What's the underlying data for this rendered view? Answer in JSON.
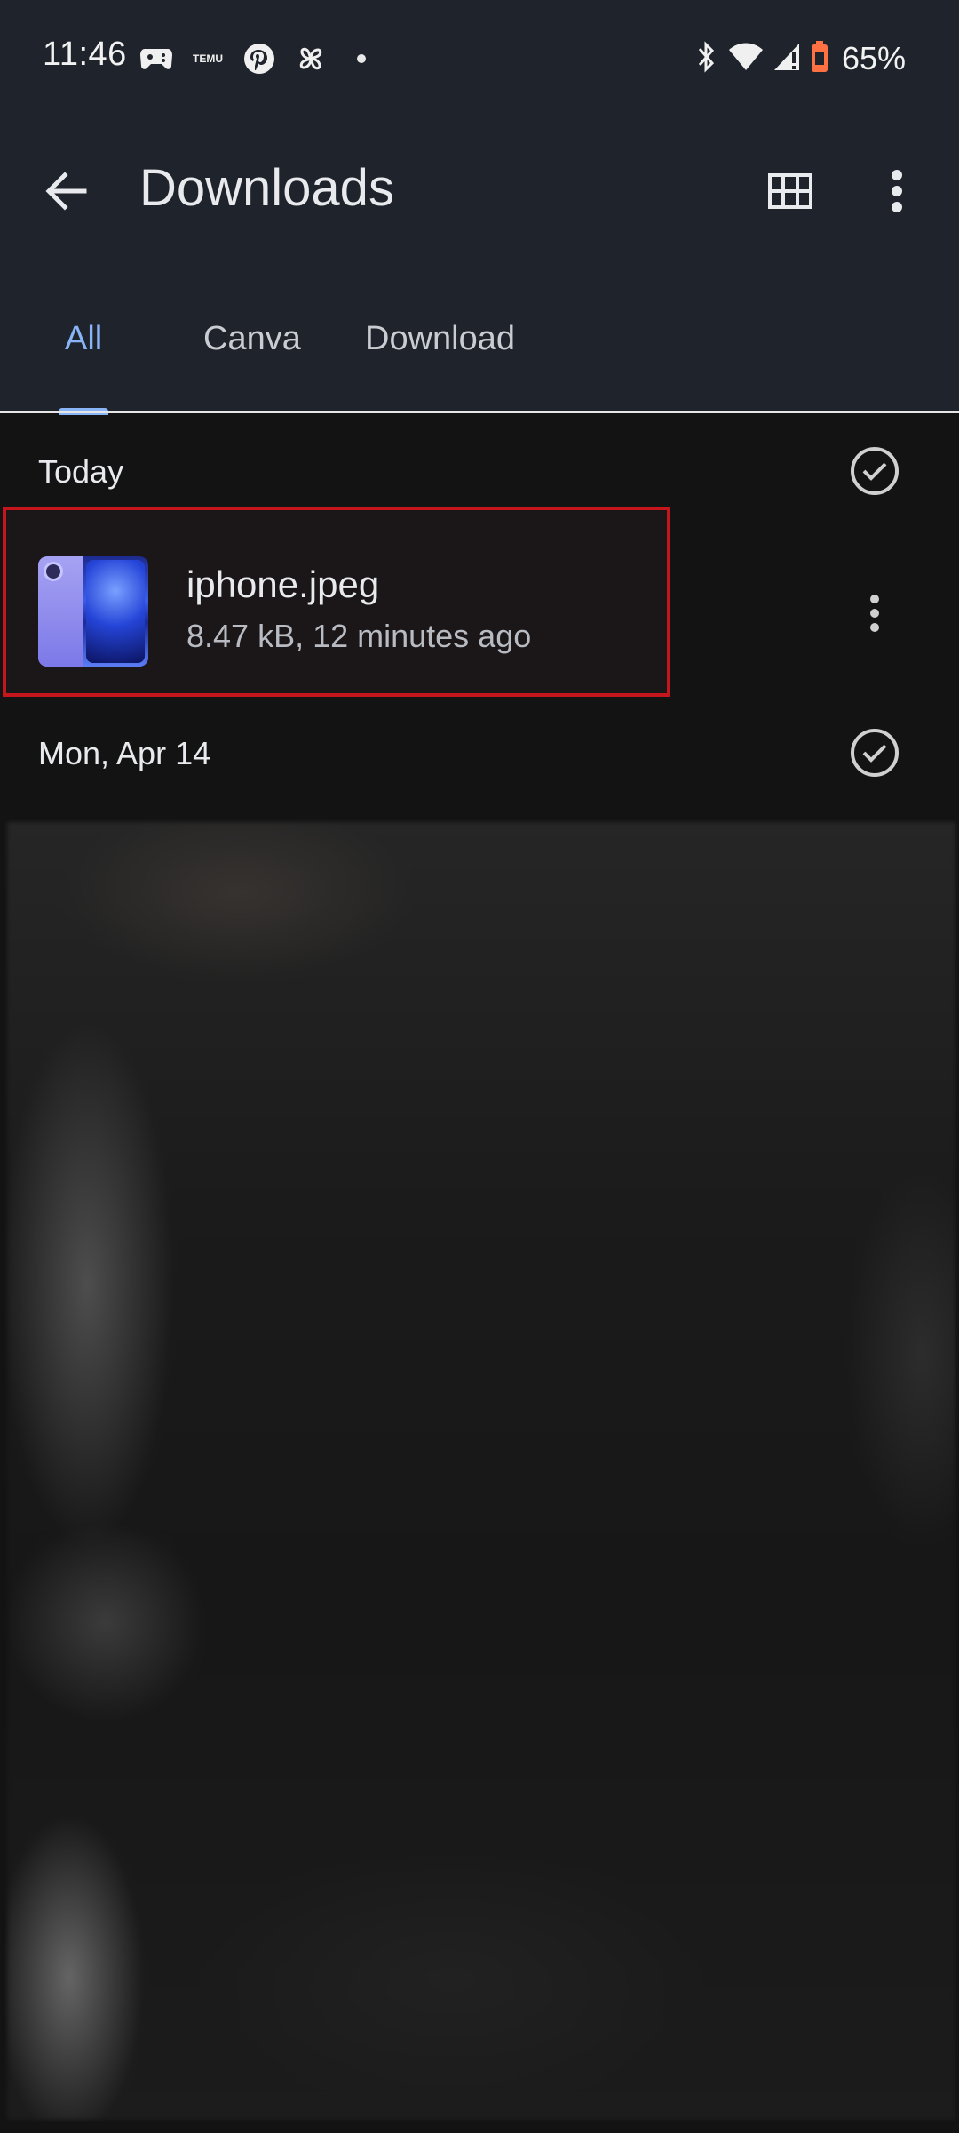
{
  "status_bar": {
    "time": "11:46",
    "temu_label": "TEMU",
    "battery_percent": "65%"
  },
  "app_bar": {
    "title": "Downloads",
    "icons": [
      "back-arrow-icon",
      "grid-view-icon",
      "more-vert-icon"
    ]
  },
  "tabs": [
    {
      "label": "All",
      "active": true
    },
    {
      "label": "Canva",
      "active": false
    },
    {
      "label": "Download",
      "active": false
    }
  ],
  "sections": [
    {
      "title": "Today",
      "files": [
        {
          "name": "iphone.jpeg",
          "meta": "8.47 kB, 12 minutes ago",
          "highlighted": true
        }
      ]
    },
    {
      "title": "Mon, Apr 14",
      "files": []
    }
  ],
  "colors": {
    "header_bg": "#1f232b",
    "page_bg": "#131313",
    "accent": "#8ab4f8",
    "highlight_border": "#c4161c"
  }
}
